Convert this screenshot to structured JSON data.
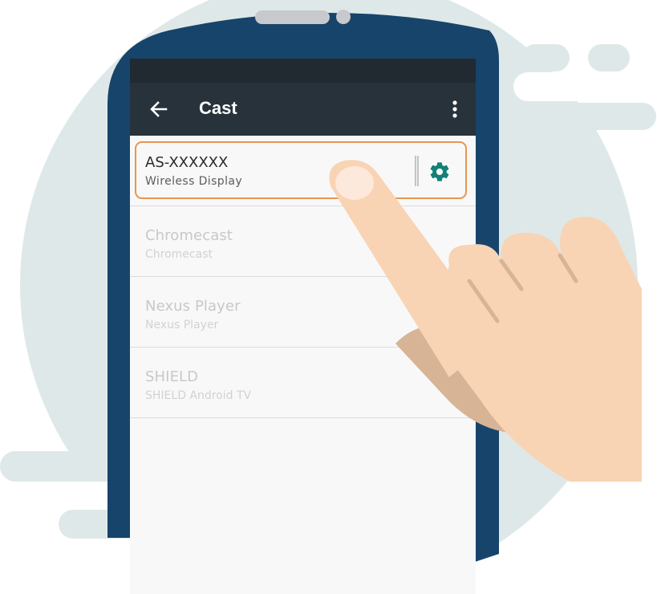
{
  "app": {
    "title": "Cast"
  },
  "toolbar": {
    "back_icon": "arrow-left-icon",
    "menu_icon": "more-vertical-icon"
  },
  "selected_device": {
    "name": "AS-XXXXXX",
    "subtitle": "Wireless Display",
    "settings_icon": "gear-icon"
  },
  "devices": [
    {
      "name": "Chromecast",
      "subtitle": "Chromecast"
    },
    {
      "name": "Nexus Player",
      "subtitle": "Nexus Player"
    },
    {
      "name": "SHIELD",
      "subtitle": "SHIELD Android TV"
    }
  ],
  "colors": {
    "phone_body": "#17446b",
    "toolbar": "#27323a",
    "status_bar": "#212a31",
    "highlight_border": "#e8964f",
    "gear": "#128178",
    "backdrop_circle": "#dfe8e8",
    "hand": "#f8d4b4"
  }
}
